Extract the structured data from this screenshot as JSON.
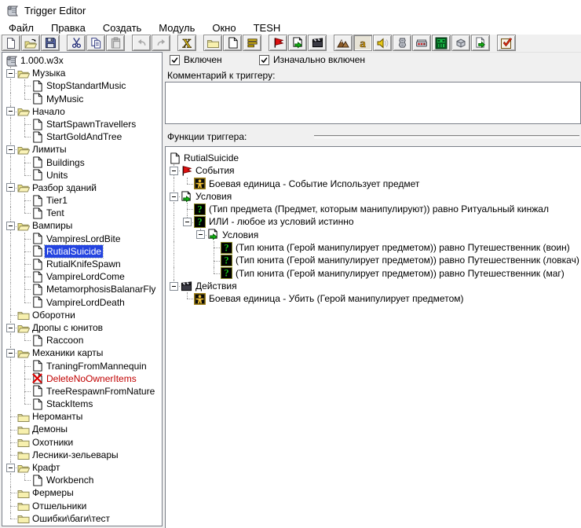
{
  "window": {
    "title": "Trigger Editor",
    "icon": "scroll-icon"
  },
  "menu": {
    "items": [
      {
        "label": "Файл"
      },
      {
        "label": "Правка"
      },
      {
        "label": "Создать"
      },
      {
        "label": "Модуль"
      },
      {
        "label": "Окно"
      },
      {
        "label": "TESH"
      }
    ]
  },
  "toolbar": {
    "buttons": [
      {
        "name": "new-map",
        "icon": "new-page"
      },
      {
        "name": "open-map",
        "icon": "open-folder"
      },
      {
        "name": "save-map",
        "icon": "save-floppy"
      },
      {
        "name": "cut",
        "icon": "scissors",
        "gap": true
      },
      {
        "name": "copy",
        "icon": "copy-pages"
      },
      {
        "name": "paste",
        "icon": "paste-clipboard",
        "enabled": false
      },
      {
        "name": "undo",
        "icon": "undo-arrow",
        "enabled": false,
        "gap": true
      },
      {
        "name": "redo",
        "icon": "redo-arrow",
        "enabled": false
      },
      {
        "name": "delete",
        "icon": "yellow-x",
        "gap": true
      },
      {
        "name": "new-category",
        "icon": "folder",
        "gap": true
      },
      {
        "name": "new-trigger",
        "icon": "trigger-page"
      },
      {
        "name": "new-comment",
        "icon": "comment-lines"
      },
      {
        "name": "new-event",
        "icon": "event-flag",
        "gap": true
      },
      {
        "name": "new-condition",
        "icon": "conditions-page"
      },
      {
        "name": "new-action",
        "icon": "actions-clapper"
      },
      {
        "name": "terrain-editor",
        "icon": "mountain",
        "gap": true
      },
      {
        "name": "trigger-editor",
        "icon": "gold-a",
        "pressed": true
      },
      {
        "name": "sound-editor",
        "icon": "speaker"
      },
      {
        "name": "object-editor",
        "icon": "gauntlet"
      },
      {
        "name": "campaign-editor",
        "icon": "campaign"
      },
      {
        "name": "ai-editor",
        "icon": "ai-face"
      },
      {
        "name": "object-manager",
        "icon": "cube"
      },
      {
        "name": "import-manager",
        "icon": "import-page"
      },
      {
        "name": "test-map",
        "icon": "test-check",
        "gap": true
      }
    ]
  },
  "map_tree": {
    "nodes": [
      {
        "label": "1.000.w3x",
        "icon": "map-scroll",
        "level": 0
      },
      {
        "label": "Музыка",
        "icon": "folder-open",
        "level": 1,
        "expand": "minus"
      },
      {
        "label": "StopStandartMusic",
        "icon": "trigger-page",
        "level": 2
      },
      {
        "label": "MyMusic",
        "icon": "trigger-page",
        "level": 2
      },
      {
        "label": "Начало",
        "icon": "folder-open",
        "level": 1,
        "expand": "minus"
      },
      {
        "label": "StartSpawnTravellers",
        "icon": "trigger-page",
        "level": 2
      },
      {
        "label": "StartGoldAndTree",
        "icon": "trigger-page",
        "level": 2
      },
      {
        "label": "Лимиты",
        "icon": "folder-open",
        "level": 1,
        "expand": "minus"
      },
      {
        "label": "Buildings",
        "icon": "trigger-page",
        "level": 2
      },
      {
        "label": "Units",
        "icon": "trigger-page",
        "level": 2
      },
      {
        "label": "Разбор зданий",
        "icon": "folder-open",
        "level": 1,
        "expand": "minus"
      },
      {
        "label": "Tier1",
        "icon": "trigger-page",
        "level": 2
      },
      {
        "label": "Tent",
        "icon": "trigger-page",
        "level": 2
      },
      {
        "label": "Вампиры",
        "icon": "folder-open",
        "level": 1,
        "expand": "minus"
      },
      {
        "label": "VampiresLordBite",
        "icon": "trigger-page",
        "level": 2
      },
      {
        "label": "RutialSuicide",
        "icon": "trigger-page",
        "level": 2,
        "selected": true
      },
      {
        "label": "RutialKnifeSpawn",
        "icon": "trigger-page",
        "level": 2
      },
      {
        "label": "VampireLordCome",
        "icon": "trigger-page",
        "level": 2
      },
      {
        "label": "MetamorphosisBalanarFly",
        "icon": "trigger-page",
        "level": 2
      },
      {
        "label": "VampireLordDeath",
        "icon": "trigger-page",
        "level": 2
      },
      {
        "label": "Оборотни",
        "icon": "folder-closed",
        "level": 1
      },
      {
        "label": "Дропы с юнитов",
        "icon": "folder-open",
        "level": 1,
        "expand": "minus"
      },
      {
        "label": "Raccoon",
        "icon": "trigger-page",
        "level": 2
      },
      {
        "label": "Механики карты",
        "icon": "folder-open",
        "level": 1,
        "expand": "minus"
      },
      {
        "label": "TraningFromMannequin",
        "icon": "trigger-page",
        "level": 2
      },
      {
        "label": "DeleteNoOwnerItems",
        "icon": "trigger-page-disabled",
        "level": 2,
        "disabled": true
      },
      {
        "label": "TreeRespawnFromNature",
        "icon": "trigger-page",
        "level": 2
      },
      {
        "label": "StackItems",
        "icon": "trigger-page",
        "level": 2
      },
      {
        "label": "Нероманты",
        "icon": "folder-closed",
        "level": 1
      },
      {
        "label": "Демоны",
        "icon": "folder-closed",
        "level": 1
      },
      {
        "label": "Охотники",
        "icon": "folder-closed",
        "level": 1
      },
      {
        "label": "Лесники-зельевары",
        "icon": "folder-closed",
        "level": 1
      },
      {
        "label": "Крафт",
        "icon": "folder-open",
        "level": 1,
        "expand": "minus"
      },
      {
        "label": "Workbench",
        "icon": "trigger-page",
        "level": 2
      },
      {
        "label": "Фермеры",
        "icon": "folder-closed",
        "level": 1
      },
      {
        "label": "Отшельники",
        "icon": "folder-closed",
        "level": 1
      },
      {
        "label": "Ошибки\\баги\\тест",
        "icon": "folder-closed",
        "level": 1
      }
    ]
  },
  "detail": {
    "enabled_checkbox": {
      "label": "Включен",
      "checked": true
    },
    "initially_on_checkbox": {
      "label": "Изначально включен",
      "checked": true
    },
    "comment_label": "Комментарий к триггеру:",
    "comment_value": "",
    "functions_label": "Функции триггера:",
    "functions_tree": {
      "nodes": [
        {
          "label": "RutialSuicide",
          "icon": "trigger-page",
          "level": 0
        },
        {
          "label": "События",
          "icon": "event-flag",
          "level": 1,
          "expand": "minus"
        },
        {
          "label": "Боевая единица - Событие Использует предмет",
          "icon": "unit-block",
          "level": 2
        },
        {
          "label": "Условия",
          "icon": "conditions-page",
          "level": 1,
          "expand": "minus"
        },
        {
          "label": "(Тип предмета (Предмет, которым манипулируют)) равно Ритуальный кинжал",
          "icon": "condition-block",
          "level": 2
        },
        {
          "label": "ИЛИ - любое из условий истинно",
          "icon": "condition-block",
          "level": 2,
          "expand": "minus"
        },
        {
          "label": "Условия",
          "icon": "conditions-page",
          "level": 3,
          "expand": "minus"
        },
        {
          "label": "(Тип юнита (Герой манипулирует предметом)) равно Путешественник (воин)",
          "icon": "condition-block",
          "level": 4
        },
        {
          "label": "(Тип юнита (Герой манипулирует предметом)) равно Путешественник (ловкач)",
          "icon": "condition-block",
          "level": 4
        },
        {
          "label": "(Тип юнита (Герой манипулирует предметом)) равно Путешественник (маг)",
          "icon": "condition-block",
          "level": 4
        },
        {
          "label": "Действия",
          "icon": "actions-clapper",
          "level": 1,
          "expand": "minus"
        },
        {
          "label": "Боевая единица - Убить (Герой манипулирует предметом)",
          "icon": "unit-block",
          "level": 2
        }
      ]
    }
  },
  "colors": {
    "selection_blue": "#2444e0",
    "disabled_trigger_red": "#c00000",
    "folder_yellow": "#f7f0ae",
    "window_bg": "#f0f0f0",
    "panel_white": "#ffffff"
  }
}
